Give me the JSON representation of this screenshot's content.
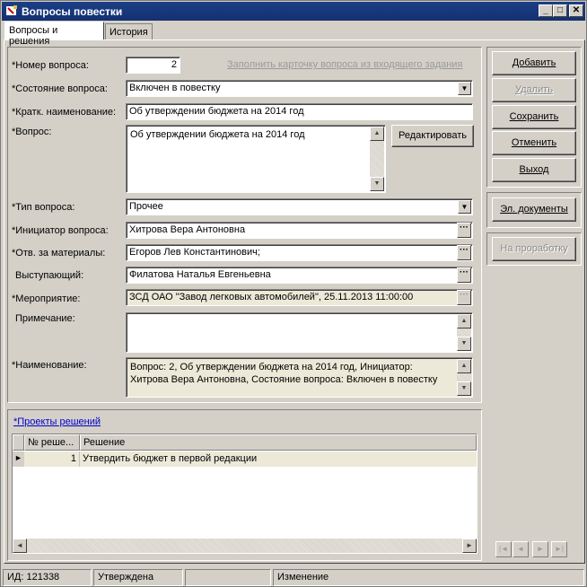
{
  "window": {
    "title": "Вопросы повестки"
  },
  "tabs": [
    "Вопросы и решения",
    "История"
  ],
  "form": {
    "number": {
      "label": "*Номер вопроса:",
      "value": "2"
    },
    "fill_link": "Заполнить карточку вопроса из входящего задания",
    "state": {
      "label": "*Состояние вопроса:",
      "value": "Включен в повестку"
    },
    "short_name": {
      "label": "*Кратк. наименование:",
      "value": "Об утверждении бюджета на 2014 год"
    },
    "question": {
      "label": "*Вопрос:",
      "value": "Об утверждении бюджета на 2014 год",
      "edit_button": "Редактировать"
    },
    "type": {
      "label": "*Тип вопроса:",
      "value": "Прочее"
    },
    "initiator": {
      "label": "*Инициатор вопроса:",
      "value": "Хитрова Вера Антоновна"
    },
    "responsible": {
      "label": "*Отв. за материалы:",
      "value": "Егоров Лев Константинович;"
    },
    "speaker": {
      "label": "Выступающий:",
      "value": "Филатова Наталья Евгеньевна"
    },
    "event": {
      "label": "*Мероприятие:",
      "value": "ЗСД ОАО \"Завод легковых автомобилей\", 25.11.2013 11:00:00"
    },
    "note": {
      "label": "Примечание:",
      "value": ""
    },
    "name": {
      "label": "*Наименование:",
      "value": "Вопрос: 2, Об утверждении бюджета на 2014 год, Инициатор: Хитрова Вера Антоновна, Состояние вопроса: Включен в повестку"
    },
    "ellipsis": "···"
  },
  "actions": {
    "add": "Добавить",
    "delete": "Удалить",
    "save": "Сохранить",
    "cancel": "Отменить",
    "exit": "Выход",
    "documents": "Эл. документы",
    "review": "На проработку"
  },
  "decisions": {
    "title": "*Проекты решений",
    "columns": [
      "№ реше...",
      "Решение"
    ],
    "rows": [
      {
        "num": "1",
        "text": "Утвердить бюджет в первой редакции"
      }
    ]
  },
  "status": {
    "id": "ИД: 121338",
    "state": "Утверждена",
    "empty": "",
    "mode": "Изменение"
  }
}
